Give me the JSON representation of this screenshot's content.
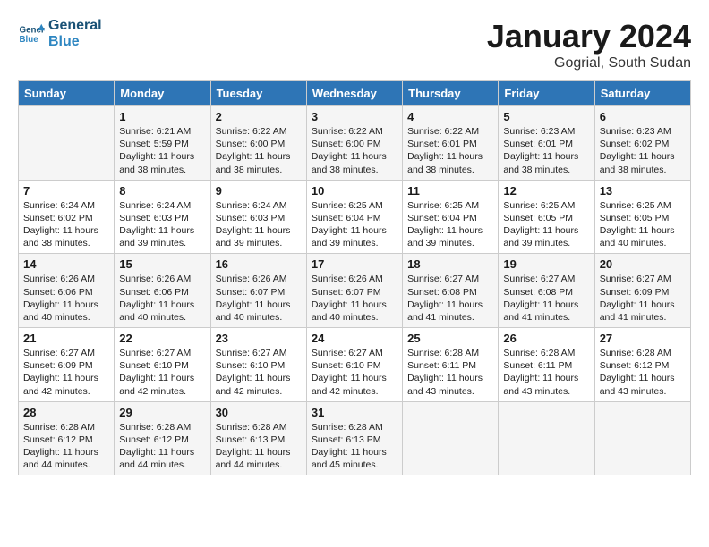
{
  "header": {
    "logo_line1": "General",
    "logo_line2": "Blue",
    "month": "January 2024",
    "location": "Gogrial, South Sudan"
  },
  "weekdays": [
    "Sunday",
    "Monday",
    "Tuesday",
    "Wednesday",
    "Thursday",
    "Friday",
    "Saturday"
  ],
  "weeks": [
    [
      {
        "day": "",
        "info": ""
      },
      {
        "day": "1",
        "info": "Sunrise: 6:21 AM\nSunset: 5:59 PM\nDaylight: 11 hours\nand 38 minutes."
      },
      {
        "day": "2",
        "info": "Sunrise: 6:22 AM\nSunset: 6:00 PM\nDaylight: 11 hours\nand 38 minutes."
      },
      {
        "day": "3",
        "info": "Sunrise: 6:22 AM\nSunset: 6:00 PM\nDaylight: 11 hours\nand 38 minutes."
      },
      {
        "day": "4",
        "info": "Sunrise: 6:22 AM\nSunset: 6:01 PM\nDaylight: 11 hours\nand 38 minutes."
      },
      {
        "day": "5",
        "info": "Sunrise: 6:23 AM\nSunset: 6:01 PM\nDaylight: 11 hours\nand 38 minutes."
      },
      {
        "day": "6",
        "info": "Sunrise: 6:23 AM\nSunset: 6:02 PM\nDaylight: 11 hours\nand 38 minutes."
      }
    ],
    [
      {
        "day": "7",
        "info": "Sunrise: 6:24 AM\nSunset: 6:02 PM\nDaylight: 11 hours\nand 38 minutes."
      },
      {
        "day": "8",
        "info": "Sunrise: 6:24 AM\nSunset: 6:03 PM\nDaylight: 11 hours\nand 39 minutes."
      },
      {
        "day": "9",
        "info": "Sunrise: 6:24 AM\nSunset: 6:03 PM\nDaylight: 11 hours\nand 39 minutes."
      },
      {
        "day": "10",
        "info": "Sunrise: 6:25 AM\nSunset: 6:04 PM\nDaylight: 11 hours\nand 39 minutes."
      },
      {
        "day": "11",
        "info": "Sunrise: 6:25 AM\nSunset: 6:04 PM\nDaylight: 11 hours\nand 39 minutes."
      },
      {
        "day": "12",
        "info": "Sunrise: 6:25 AM\nSunset: 6:05 PM\nDaylight: 11 hours\nand 39 minutes."
      },
      {
        "day": "13",
        "info": "Sunrise: 6:25 AM\nSunset: 6:05 PM\nDaylight: 11 hours\nand 40 minutes."
      }
    ],
    [
      {
        "day": "14",
        "info": "Sunrise: 6:26 AM\nSunset: 6:06 PM\nDaylight: 11 hours\nand 40 minutes."
      },
      {
        "day": "15",
        "info": "Sunrise: 6:26 AM\nSunset: 6:06 PM\nDaylight: 11 hours\nand 40 minutes."
      },
      {
        "day": "16",
        "info": "Sunrise: 6:26 AM\nSunset: 6:07 PM\nDaylight: 11 hours\nand 40 minutes."
      },
      {
        "day": "17",
        "info": "Sunrise: 6:26 AM\nSunset: 6:07 PM\nDaylight: 11 hours\nand 40 minutes."
      },
      {
        "day": "18",
        "info": "Sunrise: 6:27 AM\nSunset: 6:08 PM\nDaylight: 11 hours\nand 41 minutes."
      },
      {
        "day": "19",
        "info": "Sunrise: 6:27 AM\nSunset: 6:08 PM\nDaylight: 11 hours\nand 41 minutes."
      },
      {
        "day": "20",
        "info": "Sunrise: 6:27 AM\nSunset: 6:09 PM\nDaylight: 11 hours\nand 41 minutes."
      }
    ],
    [
      {
        "day": "21",
        "info": "Sunrise: 6:27 AM\nSunset: 6:09 PM\nDaylight: 11 hours\nand 42 minutes."
      },
      {
        "day": "22",
        "info": "Sunrise: 6:27 AM\nSunset: 6:10 PM\nDaylight: 11 hours\nand 42 minutes."
      },
      {
        "day": "23",
        "info": "Sunrise: 6:27 AM\nSunset: 6:10 PM\nDaylight: 11 hours\nand 42 minutes."
      },
      {
        "day": "24",
        "info": "Sunrise: 6:27 AM\nSunset: 6:10 PM\nDaylight: 11 hours\nand 42 minutes."
      },
      {
        "day": "25",
        "info": "Sunrise: 6:28 AM\nSunset: 6:11 PM\nDaylight: 11 hours\nand 43 minutes."
      },
      {
        "day": "26",
        "info": "Sunrise: 6:28 AM\nSunset: 6:11 PM\nDaylight: 11 hours\nand 43 minutes."
      },
      {
        "day": "27",
        "info": "Sunrise: 6:28 AM\nSunset: 6:12 PM\nDaylight: 11 hours\nand 43 minutes."
      }
    ],
    [
      {
        "day": "28",
        "info": "Sunrise: 6:28 AM\nSunset: 6:12 PM\nDaylight: 11 hours\nand 44 minutes."
      },
      {
        "day": "29",
        "info": "Sunrise: 6:28 AM\nSunset: 6:12 PM\nDaylight: 11 hours\nand 44 minutes."
      },
      {
        "day": "30",
        "info": "Sunrise: 6:28 AM\nSunset: 6:13 PM\nDaylight: 11 hours\nand 44 minutes."
      },
      {
        "day": "31",
        "info": "Sunrise: 6:28 AM\nSunset: 6:13 PM\nDaylight: 11 hours\nand 45 minutes."
      },
      {
        "day": "",
        "info": ""
      },
      {
        "day": "",
        "info": ""
      },
      {
        "day": "",
        "info": ""
      }
    ]
  ]
}
